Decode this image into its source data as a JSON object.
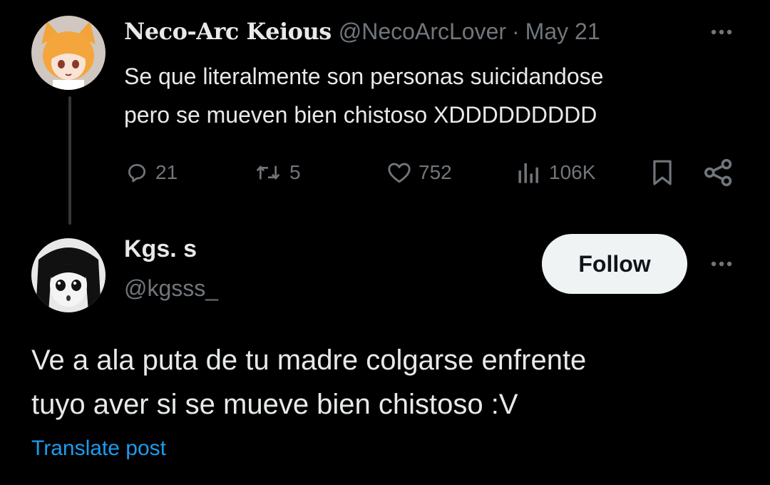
{
  "parent_tweet": {
    "author_name": "Neco-Arc Keious",
    "handle": "@NecoArcLover",
    "separator": "·",
    "date": "May 21",
    "text_lines": [
      "Se que literalmente son personas suicidandose",
      "pero se mueven bien chistoso XDDDDDDDDD"
    ],
    "actions": {
      "replies": "21",
      "reposts": "5",
      "likes": "752",
      "views": "106K"
    },
    "avatar_icon": "anime-cat-girl-avatar"
  },
  "reply_tweet": {
    "author_name": "Kgs. s",
    "handle": "@kgsss_",
    "follow_label": "Follow",
    "text_lines": [
      "Ve a ala puta de tu madre colgarse enfrente",
      "tuyo aver si se mueve bien chistoso :V"
    ],
    "translate_label": "Translate post",
    "avatar_icon": "manga-girl-avatar"
  },
  "colors": {
    "background": "#000000",
    "primary_text": "#e7e9ea",
    "secondary_text": "#71767b",
    "link": "#1d9bf0",
    "follow_button_bg": "#eff3f4"
  },
  "icons": [
    "reply-icon",
    "repost-icon",
    "like-icon",
    "views-icon",
    "bookmark-icon",
    "share-icon",
    "more-icon"
  ]
}
